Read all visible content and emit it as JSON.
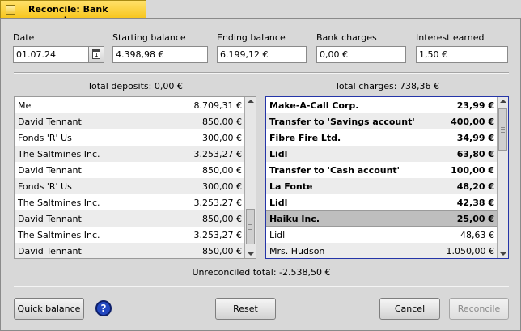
{
  "window": {
    "title": "Reconcile: Bank account"
  },
  "fields": {
    "date": {
      "label": "Date",
      "value": "01.07.24"
    },
    "starting_balance": {
      "label": "Starting balance",
      "value": "4.398,98 €"
    },
    "ending_balance": {
      "label": "Ending balance",
      "value": "6.199,12 €"
    },
    "bank_charges": {
      "label": "Bank charges",
      "value": "0,00 €"
    },
    "interest_earned": {
      "label": "Interest earned",
      "value": "1,50 €"
    }
  },
  "calendar_icon_text": "1",
  "deposits": {
    "total_label": "Total deposits: 0,00 €",
    "rows": [
      {
        "payee": "Me",
        "amount": "8.709,31 €"
      },
      {
        "payee": "David Tennant",
        "amount": "850,00 €"
      },
      {
        "payee": "Fonds 'R' Us",
        "amount": "300,00 €"
      },
      {
        "payee": "The Saltmines Inc.",
        "amount": "3.253,27 €"
      },
      {
        "payee": "David Tennant",
        "amount": "850,00 €"
      },
      {
        "payee": "Fonds 'R' Us",
        "amount": "300,00 €"
      },
      {
        "payee": "The Saltmines Inc.",
        "amount": "3.253,27 €"
      },
      {
        "payee": "David Tennant",
        "amount": "850,00 €"
      },
      {
        "payee": "The Saltmines Inc.",
        "amount": "3.253,27 €"
      },
      {
        "payee": "David Tennant",
        "amount": "850,00 €"
      }
    ]
  },
  "charges": {
    "total_label": "Total charges: 738,36 €",
    "rows": [
      {
        "payee": "Make-A-Call Corp.",
        "amount": "23,99 €"
      },
      {
        "payee": "Transfer to 'Savings account'",
        "amount": "400,00 €"
      },
      {
        "payee": "Fibre Fire Ltd.",
        "amount": "34,99 €"
      },
      {
        "payee": "Lidl",
        "amount": "63,80 €"
      },
      {
        "payee": "Transfer to 'Cash account'",
        "amount": "100,00 €"
      },
      {
        "payee": "La Fonte",
        "amount": "48,20 €"
      },
      {
        "payee": "Lidl",
        "amount": "42,38 €"
      },
      {
        "payee": "Haiku Inc.",
        "amount": "25,00 €"
      },
      {
        "payee": "Lidl",
        "amount": "48,63 €"
      },
      {
        "payee": "Mrs. Hudson",
        "amount": "1.050,00 €"
      }
    ]
  },
  "unreconciled_total": "Unreconciled total: -2.538,50 €",
  "buttons": {
    "quick_balance": "Quick balance",
    "help": "?",
    "reset": "Reset",
    "cancel": "Cancel",
    "reconcile": "Reconcile"
  },
  "colors": {
    "title_tab": "#f7c61f",
    "focus_border": "#2535a8",
    "help_icon": "#2247c0"
  }
}
